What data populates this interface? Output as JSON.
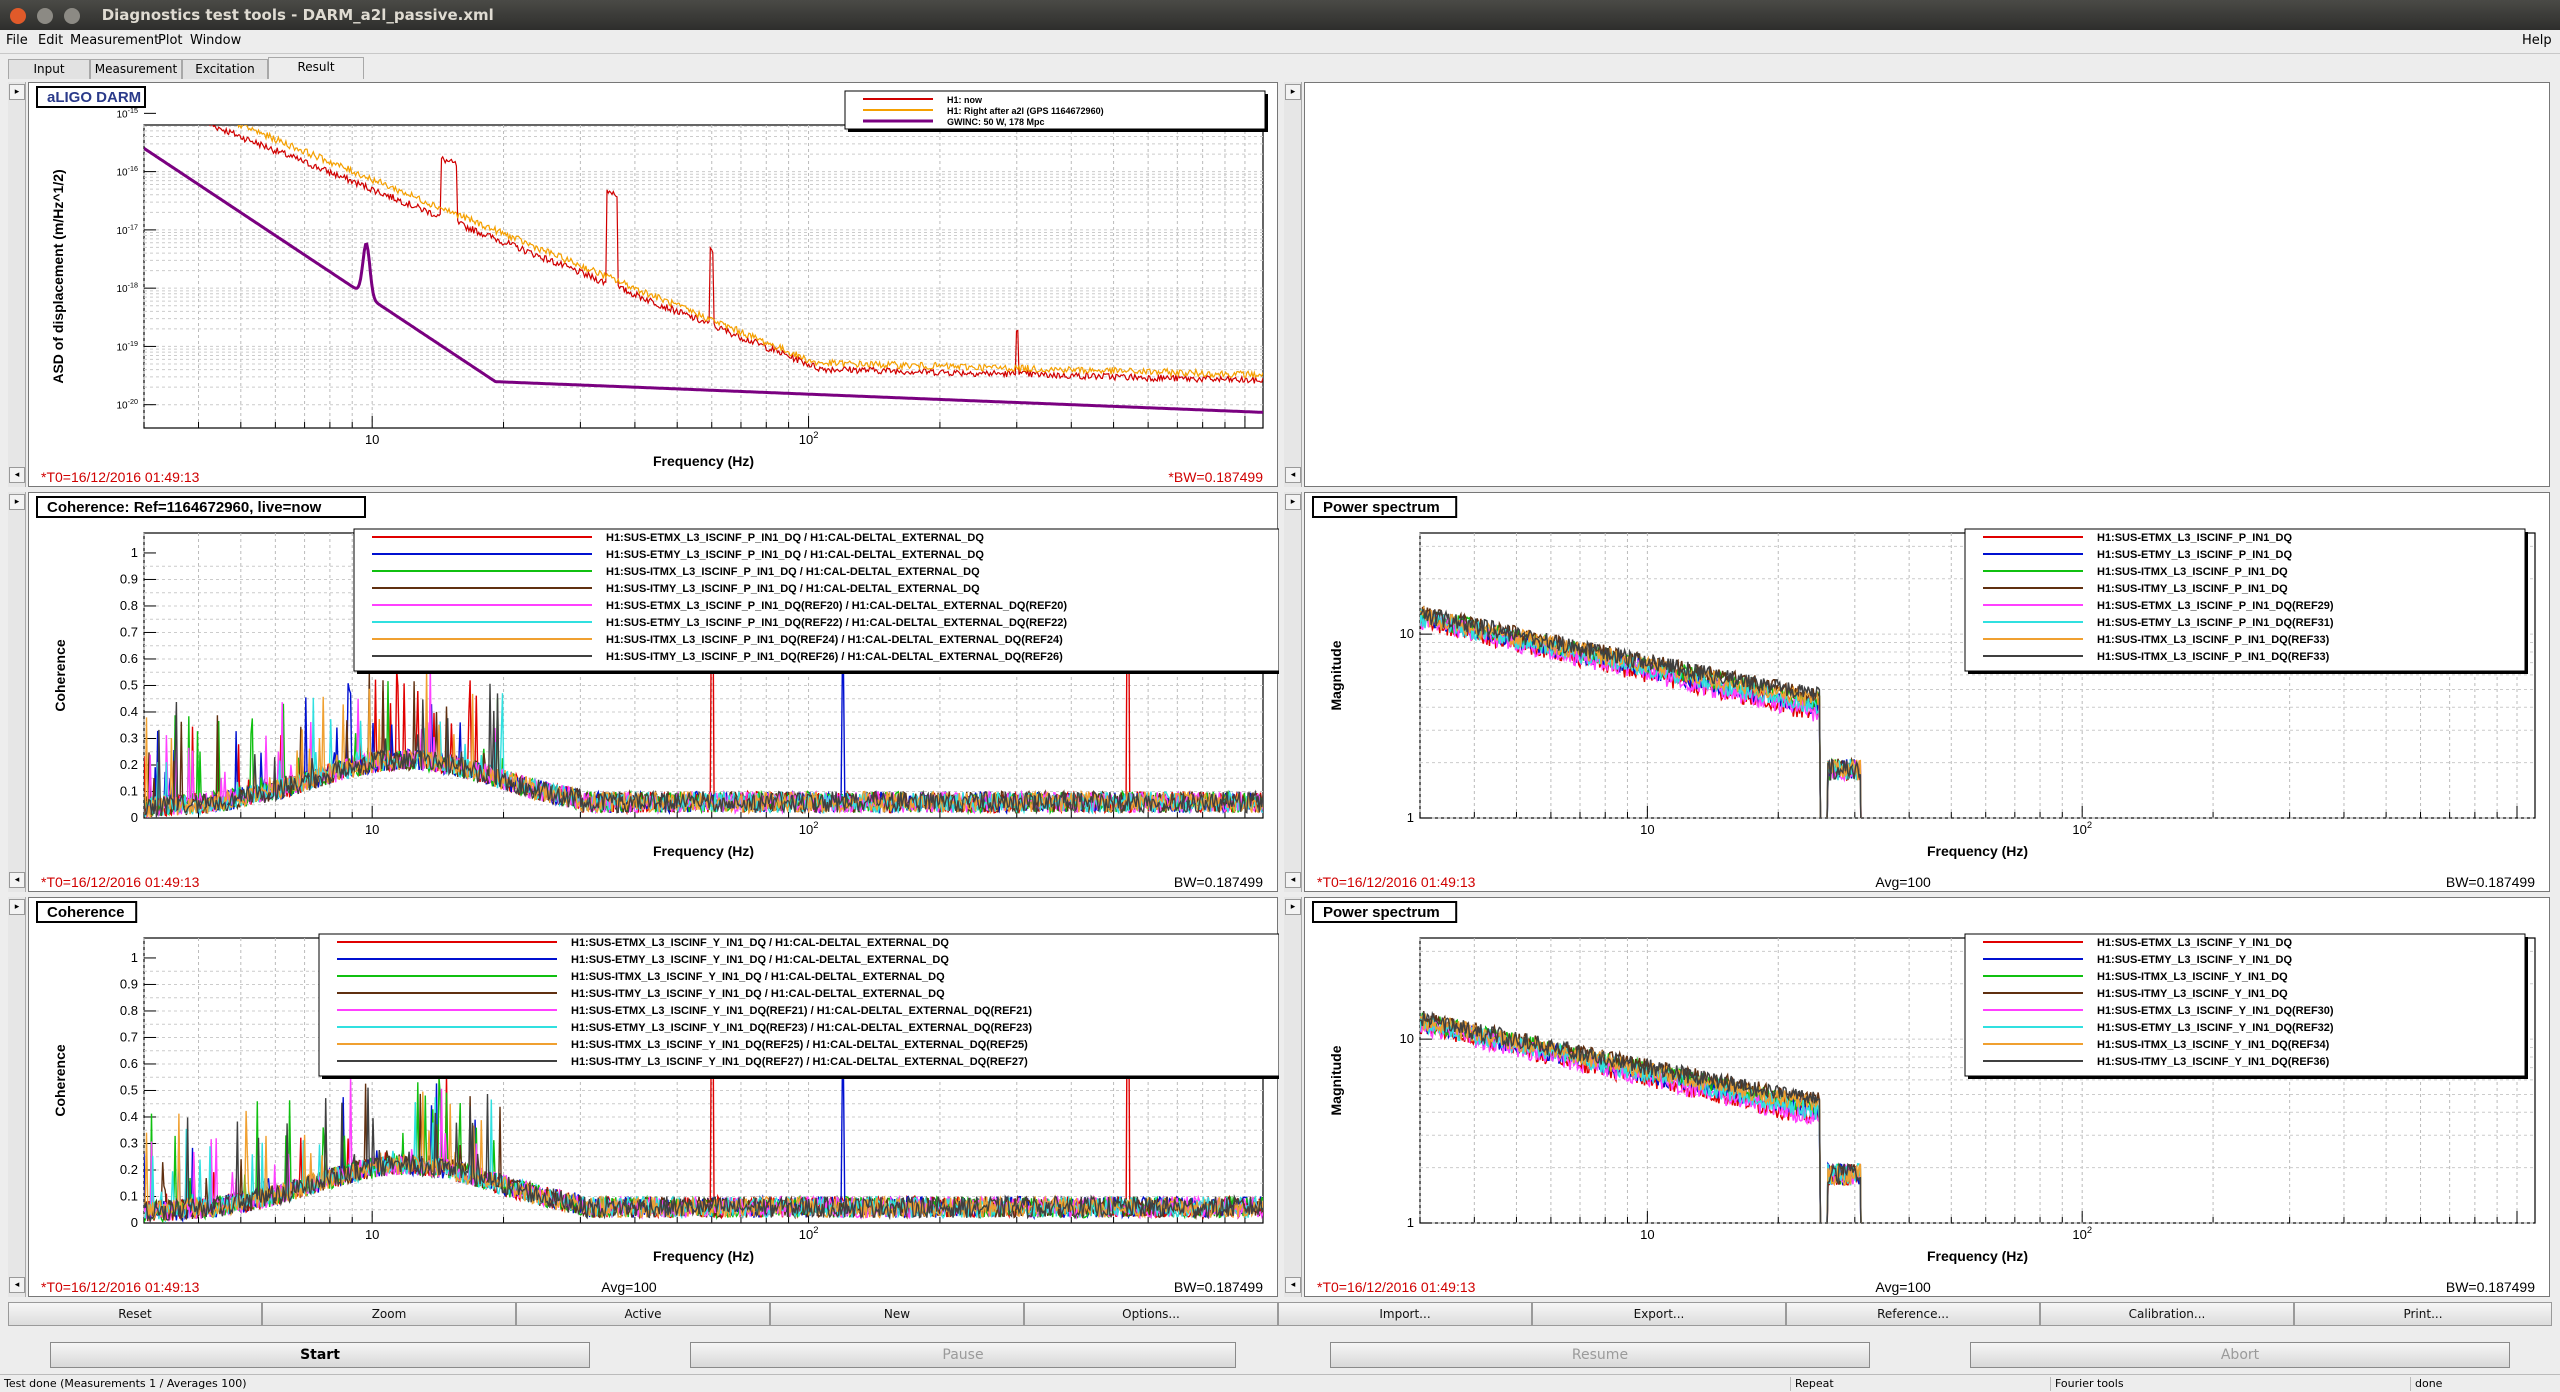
{
  "window": {
    "title": "Diagnostics test tools - DARM_a2l_passive.xml"
  },
  "menu": {
    "items": [
      "File",
      "Edit",
      "Measurement",
      "Plot",
      "Window"
    ],
    "help": "Help"
  },
  "tabs": [
    "Input",
    "Measurement",
    "Excitation",
    "Result"
  ],
  "active_tab": "Result",
  "panels": [
    {
      "id": "p1",
      "title": "aLIGO DARM",
      "ylabel": "ASD of displacement (m/Hz^1/2)",
      "xlabel": "Frequency (Hz)",
      "footer_left": "*T0=16/12/2016 01:49:13",
      "footer_center": "",
      "footer_right": "*BW=0.187499",
      "yticks": [
        "10^-15",
        "10^-16",
        "10^-17",
        "10^-18",
        "10^-19",
        "10^-20"
      ],
      "xticks": [
        "10",
        "10^2"
      ],
      "legend": [
        {
          "label": "H1: now",
          "color": "#d00000"
        },
        {
          "label": "H1: Right after a2l (GPS 1164672960)",
          "color": "#f5a000"
        },
        {
          "label": "GWINC: 50 W, 178 Mpc",
          "color": "#7a0080"
        }
      ]
    },
    {
      "id": "p2",
      "title": "",
      "empty": true
    },
    {
      "id": "p3",
      "title": "Coherence: Ref=1164672960, live=now",
      "ylabel": "Coherence",
      "xlabel": "Frequency (Hz)",
      "footer_left": "*T0=16/12/2016 01:49:13",
      "footer_center": "",
      "footer_right": "BW=0.187499",
      "yticks": [
        "1",
        "0.9",
        "0.8",
        "0.7",
        "0.6",
        "0.5",
        "0.4",
        "0.3",
        "0.2",
        "0.1",
        "0"
      ],
      "xticks": [
        "10",
        "10^2"
      ],
      "legend": [
        {
          "label": "H1:SUS-ETMX_L3_ISCINF_P_IN1_DQ / H1:CAL-DELTAL_EXTERNAL_DQ",
          "color": "#e00000"
        },
        {
          "label": "H1:SUS-ETMY_L3_ISCINF_P_IN1_DQ / H1:CAL-DELTAL_EXTERNAL_DQ",
          "color": "#0010d0"
        },
        {
          "label": "H1:SUS-ITMX_L3_ISCINF_P_IN1_DQ / H1:CAL-DELTAL_EXTERNAL_DQ",
          "color": "#10c010"
        },
        {
          "label": "H1:SUS-ITMY_L3_ISCINF_P_IN1_DQ / H1:CAL-DELTAL_EXTERNAL_DQ",
          "color": "#603010"
        },
        {
          "label": "H1:SUS-ETMX_L3_ISCINF_P_IN1_DQ(REF20) / H1:CAL-DELTAL_EXTERNAL_DQ(REF20)",
          "color": "#ff40ff"
        },
        {
          "label": "H1:SUS-ETMY_L3_ISCINF_P_IN1_DQ(REF22) / H1:CAL-DELTAL_EXTERNAL_DQ(REF22)",
          "color": "#30e0e0"
        },
        {
          "label": "H1:SUS-ITMX_L3_ISCINF_P_IN1_DQ(REF24) / H1:CAL-DELTAL_EXTERNAL_DQ(REF24)",
          "color": "#f0a030"
        },
        {
          "label": "H1:SUS-ITMY_L3_ISCINF_P_IN1_DQ(REF26) / H1:CAL-DELTAL_EXTERNAL_DQ(REF26)",
          "color": "#404040"
        }
      ]
    },
    {
      "id": "p4",
      "title": "Power spectrum",
      "ylabel": "Magnitude",
      "xlabel": "Frequency (Hz)",
      "footer_left": "*T0=16/12/2016 01:49:13",
      "footer_center": "Avg=100",
      "footer_right": "BW=0.187499",
      "yticks": [
        "10",
        "1"
      ],
      "xticks": [
        "10",
        "10^2"
      ],
      "legend": [
        {
          "label": "H1:SUS-ETMX_L3_ISCINF_P_IN1_DQ",
          "color": "#e00000"
        },
        {
          "label": "H1:SUS-ETMY_L3_ISCINF_P_IN1_DQ",
          "color": "#0010d0"
        },
        {
          "label": "H1:SUS-ITMX_L3_ISCINF_P_IN1_DQ",
          "color": "#10c010"
        },
        {
          "label": "H1:SUS-ITMY_L3_ISCINF_P_IN1_DQ",
          "color": "#603010"
        },
        {
          "label": "H1:SUS-ETMX_L3_ISCINF_P_IN1_DQ(REF29)",
          "color": "#ff40ff"
        },
        {
          "label": "H1:SUS-ETMY_L3_ISCINF_P_IN1_DQ(REF31)",
          "color": "#30e0e0"
        },
        {
          "label": "H1:SUS-ITMX_L3_ISCINF_P_IN1_DQ(REF33)",
          "color": "#f0a030"
        },
        {
          "label": "H1:SUS-ITMX_L3_ISCINF_P_IN1_DQ(REF33)",
          "color": "#404040"
        }
      ]
    },
    {
      "id": "p5",
      "title": "Coherence",
      "ylabel": "Coherence",
      "xlabel": "Frequency (Hz)",
      "footer_left": "*T0=16/12/2016 01:49:13",
      "footer_center": "Avg=100",
      "footer_right": "BW=0.187499",
      "yticks": [
        "1",
        "0.9",
        "0.8",
        "0.7",
        "0.6",
        "0.5",
        "0.4",
        "0.3",
        "0.2",
        "0.1",
        "0"
      ],
      "xticks": [
        "10",
        "10^2"
      ],
      "legend": [
        {
          "label": "H1:SUS-ETMX_L3_ISCINF_Y_IN1_DQ / H1:CAL-DELTAL_EXTERNAL_DQ",
          "color": "#e00000"
        },
        {
          "label": "H1:SUS-ETMY_L3_ISCINF_Y_IN1_DQ / H1:CAL-DELTAL_EXTERNAL_DQ",
          "color": "#0010d0"
        },
        {
          "label": "H1:SUS-ITMX_L3_ISCINF_Y_IN1_DQ / H1:CAL-DELTAL_EXTERNAL_DQ",
          "color": "#10c010"
        },
        {
          "label": "H1:SUS-ITMY_L3_ISCINF_Y_IN1_DQ / H1:CAL-DELTAL_EXTERNAL_DQ",
          "color": "#603010"
        },
        {
          "label": "H1:SUS-ETMX_L3_ISCINF_Y_IN1_DQ(REF21) / H1:CAL-DELTAL_EXTERNAL_DQ(REF21)",
          "color": "#ff40ff"
        },
        {
          "label": "H1:SUS-ETMY_L3_ISCINF_Y_IN1_DQ(REF23) / H1:CAL-DELTAL_EXTERNAL_DQ(REF23)",
          "color": "#30e0e0"
        },
        {
          "label": "H1:SUS-ITMX_L3_ISCINF_Y_IN1_DQ(REF25) / H1:CAL-DELTAL_EXTERNAL_DQ(REF25)",
          "color": "#f0a030"
        },
        {
          "label": "H1:SUS-ITMY_L3_ISCINF_Y_IN1_DQ(REF27) / H1:CAL-DELTAL_EXTERNAL_DQ(REF27)",
          "color": "#404040"
        }
      ]
    },
    {
      "id": "p6",
      "title": "Power spectrum",
      "ylabel": "Magnitude",
      "xlabel": "Frequency (Hz)",
      "footer_left": "*T0=16/12/2016 01:49:13",
      "footer_center": "Avg=100",
      "footer_right": "BW=0.187499",
      "yticks": [
        "10",
        "1"
      ],
      "xticks": [
        "10",
        "10^2"
      ],
      "legend": [
        {
          "label": "H1:SUS-ETMX_L3_ISCINF_Y_IN1_DQ",
          "color": "#e00000"
        },
        {
          "label": "H1:SUS-ETMY_L3_ISCINF_Y_IN1_DQ",
          "color": "#0010d0"
        },
        {
          "label": "H1:SUS-ITMX_L3_ISCINF_Y_IN1_DQ",
          "color": "#10c010"
        },
        {
          "label": "H1:SUS-ITMY_L3_ISCINF_Y_IN1_DQ",
          "color": "#603010"
        },
        {
          "label": "H1:SUS-ETMX_L3_ISCINF_Y_IN1_DQ(REF30)",
          "color": "#ff40ff"
        },
        {
          "label": "H1:SUS-ETMY_L3_ISCINF_Y_IN1_DQ(REF32)",
          "color": "#30e0e0"
        },
        {
          "label": "H1:SUS-ITMX_L3_ISCINF_Y_IN1_DQ(REF34)",
          "color": "#f0a030"
        },
        {
          "label": "H1:SUS-ITMY_L3_ISCINF_Y_IN1_DQ(REF36)",
          "color": "#404040"
        }
      ]
    }
  ],
  "toolbar": [
    "Reset",
    "Zoom",
    "Active",
    "New",
    "Options...",
    "Import...",
    "Export...",
    "Reference...",
    "Calibration...",
    "Print..."
  ],
  "actions": [
    {
      "label": "Start",
      "enabled": true
    },
    {
      "label": "Pause",
      "enabled": false
    },
    {
      "label": "Resume",
      "enabled": false
    },
    {
      "label": "Abort",
      "enabled": false
    }
  ],
  "status": {
    "message": "Test done (Measurements 1 / Averages 100)",
    "mode": "Repeat",
    "tool": "Fourier tools",
    "state": "done"
  }
}
